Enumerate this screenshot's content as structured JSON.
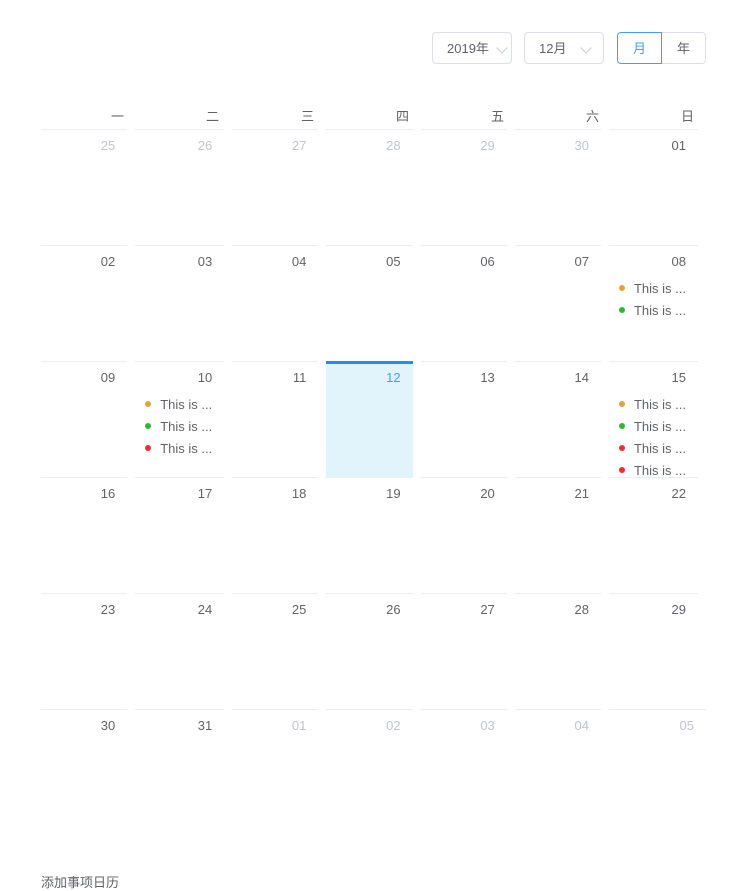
{
  "header": {
    "year_select": {
      "value": "2019年",
      "icon": "chevron-down-icon"
    },
    "month_select": {
      "value": "12月",
      "icon": "chevron-down-icon"
    },
    "view_toggle": {
      "month_label": "月",
      "year_label": "年",
      "active": "月"
    },
    "accent_color": "#409eff",
    "selected_border_color": "#1890ff"
  },
  "weekdays": [
    "一",
    "二",
    "三",
    "四",
    "五",
    "六",
    "日"
  ],
  "event_colors": {
    "orange": "#e6a23c",
    "green": "#2eb82e",
    "red": "#f12d2d"
  },
  "event_label": "This is ...",
  "footer": {
    "note": "添加事项日历"
  },
  "weeks": [
    [
      {
        "day": "25",
        "other": true,
        "selected": false,
        "events": []
      },
      {
        "day": "26",
        "other": true,
        "selected": false,
        "events": []
      },
      {
        "day": "27",
        "other": true,
        "selected": false,
        "events": []
      },
      {
        "day": "28",
        "other": true,
        "selected": false,
        "events": []
      },
      {
        "day": "29",
        "other": true,
        "selected": false,
        "events": []
      },
      {
        "day": "30",
        "other": true,
        "selected": false,
        "events": []
      },
      {
        "day": "01",
        "other": false,
        "selected": false,
        "events": []
      }
    ],
    [
      {
        "day": "02",
        "other": false,
        "selected": false,
        "events": []
      },
      {
        "day": "03",
        "other": false,
        "selected": false,
        "events": []
      },
      {
        "day": "04",
        "other": false,
        "selected": false,
        "events": []
      },
      {
        "day": "05",
        "other": false,
        "selected": false,
        "events": []
      },
      {
        "day": "06",
        "other": false,
        "selected": false,
        "events": []
      },
      {
        "day": "07",
        "other": false,
        "selected": false,
        "events": []
      },
      {
        "day": "08",
        "other": false,
        "selected": false,
        "events": [
          {
            "color": "orange",
            "text": "This is ..."
          },
          {
            "color": "green",
            "text": "This is ..."
          }
        ]
      }
    ],
    [
      {
        "day": "09",
        "other": false,
        "selected": false,
        "events": []
      },
      {
        "day": "10",
        "other": false,
        "selected": false,
        "events": [
          {
            "color": "orange",
            "text": "This is ..."
          },
          {
            "color": "green",
            "text": "This is ..."
          },
          {
            "color": "red",
            "text": "This is ..."
          }
        ]
      },
      {
        "day": "11",
        "other": false,
        "selected": false,
        "events": []
      },
      {
        "day": "12",
        "other": false,
        "selected": true,
        "events": []
      },
      {
        "day": "13",
        "other": false,
        "selected": false,
        "events": []
      },
      {
        "day": "14",
        "other": false,
        "selected": false,
        "events": []
      },
      {
        "day": "15",
        "other": false,
        "selected": false,
        "events": [
          {
            "color": "orange",
            "text": "This is ..."
          },
          {
            "color": "green",
            "text": "This is ..."
          },
          {
            "color": "red",
            "text": "This is ..."
          },
          {
            "color": "red",
            "text": "This is ..."
          }
        ]
      }
    ],
    [
      {
        "day": "16",
        "other": false,
        "selected": false,
        "events": []
      },
      {
        "day": "17",
        "other": false,
        "selected": false,
        "events": []
      },
      {
        "day": "18",
        "other": false,
        "selected": false,
        "events": []
      },
      {
        "day": "19",
        "other": false,
        "selected": false,
        "events": []
      },
      {
        "day": "20",
        "other": false,
        "selected": false,
        "events": []
      },
      {
        "day": "21",
        "other": false,
        "selected": false,
        "events": []
      },
      {
        "day": "22",
        "other": false,
        "selected": false,
        "events": []
      }
    ],
    [
      {
        "day": "23",
        "other": false,
        "selected": false,
        "events": []
      },
      {
        "day": "24",
        "other": false,
        "selected": false,
        "events": []
      },
      {
        "day": "25",
        "other": false,
        "selected": false,
        "events": []
      },
      {
        "day": "26",
        "other": false,
        "selected": false,
        "events": []
      },
      {
        "day": "27",
        "other": false,
        "selected": false,
        "events": []
      },
      {
        "day": "28",
        "other": false,
        "selected": false,
        "events": []
      },
      {
        "day": "29",
        "other": false,
        "selected": false,
        "events": []
      }
    ],
    [
      {
        "day": "30",
        "other": false,
        "selected": false,
        "events": []
      },
      {
        "day": "31",
        "other": false,
        "selected": false,
        "events": []
      },
      {
        "day": "01",
        "other": true,
        "selected": false,
        "events": []
      },
      {
        "day": "02",
        "other": true,
        "selected": false,
        "events": []
      },
      {
        "day": "03",
        "other": true,
        "selected": false,
        "events": []
      },
      {
        "day": "04",
        "other": true,
        "selected": false,
        "events": []
      },
      {
        "day": "05",
        "other": true,
        "selected": false,
        "events": []
      }
    ]
  ]
}
